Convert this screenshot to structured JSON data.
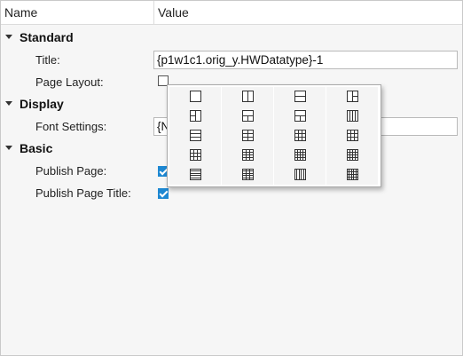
{
  "header": {
    "name_col": "Name",
    "value_col": "Value"
  },
  "sections": {
    "standard": {
      "title": "Standard",
      "title_label": "Title:",
      "title_value": "{p1w1c1.orig_y.HWDatatype}-1",
      "page_layout_label": "Page Layout:"
    },
    "display": {
      "title": "Display",
      "font_settings_label": "Font Settings:",
      "font_settings_value": "{N"
    },
    "basic": {
      "title": "Basic",
      "publish_page_label": "Publish Page:",
      "publish_page_checked": true,
      "publish_page_title_label": "Publish Page Title:",
      "publish_page_title_checked": true
    }
  },
  "layout_picker": {
    "columns": [
      [
        "layout-1x1-icon",
        "layout-left-split-icon",
        "layout-3-rows-icon",
        "layout-grid-3x3-icon",
        "layout-5-rows-icon"
      ],
      [
        "layout-2-columns-icon",
        "layout-top-split-icon",
        "layout-grid-2x3-icon",
        "layout-grid-4x3-icon",
        "layout-grid-5x3-icon"
      ],
      [
        "layout-2-rows-icon",
        "layout-bottom-split-icon",
        "layout-grid-3x3b-icon",
        "layout-grid-4x4-icon",
        "layout-grid-5-columns-icon"
      ],
      [
        "layout-right-split-icon",
        "layout-4-columns-icon",
        "layout-grid-3x3c-icon",
        "layout-grid-4x4b-icon",
        "layout-grid-4x5-icon"
      ]
    ]
  },
  "colors": {
    "accent": "#1e88d2",
    "panel_bg": "#f6f6f6"
  }
}
